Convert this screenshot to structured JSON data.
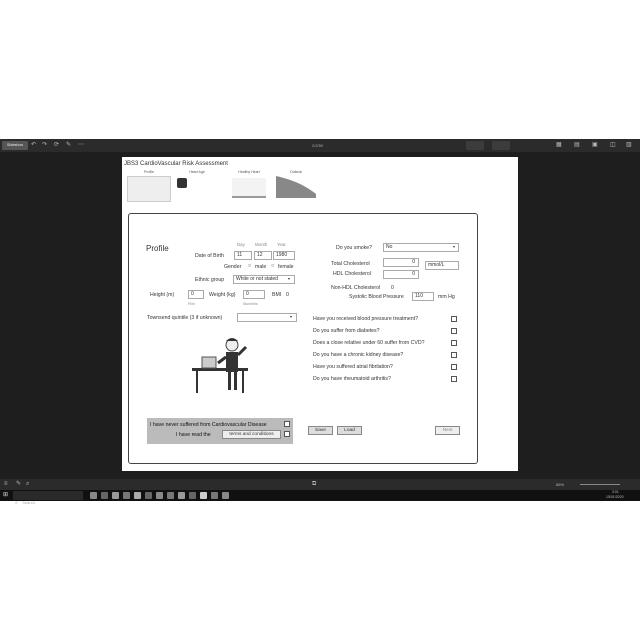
{
  "window": {
    "title": "Presenter",
    "slide_title": "2/2/50",
    "top_button": "Slideshow"
  },
  "slide": {
    "app_title": "JBS3 CardioVascular Risk Assessment",
    "thumbnails": [
      "Profile",
      "Heart Age",
      "Healthy Heart",
      "Outlook"
    ]
  },
  "profile": {
    "heading": "Profile",
    "dob_label": "Date of Birth",
    "day_label": "Day",
    "month_label": "Month",
    "year_label": "Year",
    "day_value": "11",
    "month_value": "12",
    "year_value": "1980",
    "gender_label": "Gender",
    "male_label": "male",
    "female_label": "female",
    "ethnic_label": "Ethnic group",
    "ethnic_value": "White or not stated",
    "height_label": "Height (m)",
    "height_value": "0",
    "height_unit": "Ft/in",
    "weight_label": "Weight (kg)",
    "weight_value": "0",
    "weight_unit": "Stone/lbs",
    "bmi_label": "BMI",
    "bmi_value": "0",
    "townsend_label": "Townsend quintile (3 if unknown)",
    "townsend_value": "",
    "smoke_label": "Do you smoke?",
    "smoke_value": "No",
    "total_chol_label": "Total Cholesterol",
    "total_chol_value": "0",
    "chol_unit": "mmol/L",
    "hdl_label": "HDL Cholesterol",
    "hdl_value": "0",
    "nonhdl_label": "Non-HDL Cholesterol",
    "nonhdl_value": "0",
    "sbp_label": "Systolic Blood Pressure",
    "sbp_value": "110",
    "sbp_unit": "mm Hg",
    "questions": [
      "Have you received blood pressure treatment?",
      "Do you suffer from diabetes?",
      "Does a close relative under 60 suffer from CVD?",
      "Do you have a chronic kidney disease?",
      "Have you suffered atrial fibrilation?",
      "Do you have rheumatoid arthritis?"
    ],
    "never_suffered": "I have never suffered from Cardiovascular Disease",
    "read_terms_prefix": "I have read the",
    "terms_button": "terms and conditions",
    "save_button": "Save",
    "load_button": "Load",
    "next_button": "Next"
  },
  "status": {
    "zoom": "65%",
    "time": "3:01",
    "date": "15/01/2020",
    "search_placeholder": "Search"
  }
}
